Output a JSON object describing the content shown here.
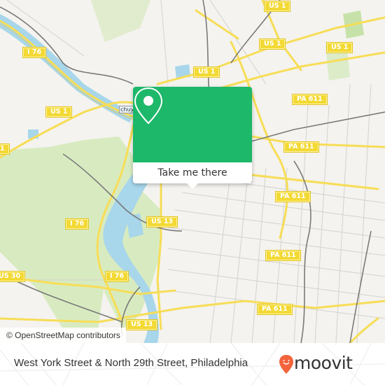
{
  "map": {
    "attribution": "© OpenStreetMap contributors",
    "partial_label": "chuy",
    "shields": [
      {
        "id": "i76-a",
        "label": "I 76"
      },
      {
        "id": "us1-a",
        "label": "US 1"
      },
      {
        "id": "us1-b",
        "label": "US 1"
      },
      {
        "id": "us1-c",
        "label": "US 1"
      },
      {
        "id": "us1-d",
        "label": "US 1"
      },
      {
        "id": "us1-e",
        "label": "US 1"
      },
      {
        "id": "pa611-a",
        "label": "PA 611"
      },
      {
        "id": "pa611-b",
        "label": "PA 611"
      },
      {
        "id": "pa611-c",
        "label": "PA 611"
      },
      {
        "id": "pa611-d",
        "label": "PA 611"
      },
      {
        "id": "pa611-e",
        "label": "PA 611"
      },
      {
        "id": "i76-b",
        "label": "I 76"
      },
      {
        "id": "i76-c",
        "label": "I 76"
      },
      {
        "id": "us13-a",
        "label": "US 13"
      },
      {
        "id": "us13-b",
        "label": "US 13"
      },
      {
        "id": "us30",
        "label": "US 30"
      },
      {
        "id": "us1-f",
        "label": "1"
      }
    ],
    "colors": {
      "land": "#f4f3ef",
      "park": "#d8ebc0",
      "water": "#a8d6ea",
      "highway": "#f7dd57",
      "rail": "#777777",
      "minor_road": "#cfcfcf"
    }
  },
  "popup": {
    "icon": "location-pin-icon",
    "button_label": "Take me there",
    "color": "#1db86a"
  },
  "footer": {
    "address": "West York Street & North 29th Street, Philadelphia",
    "brand": "moovit",
    "brand_color": "#f4643c"
  }
}
